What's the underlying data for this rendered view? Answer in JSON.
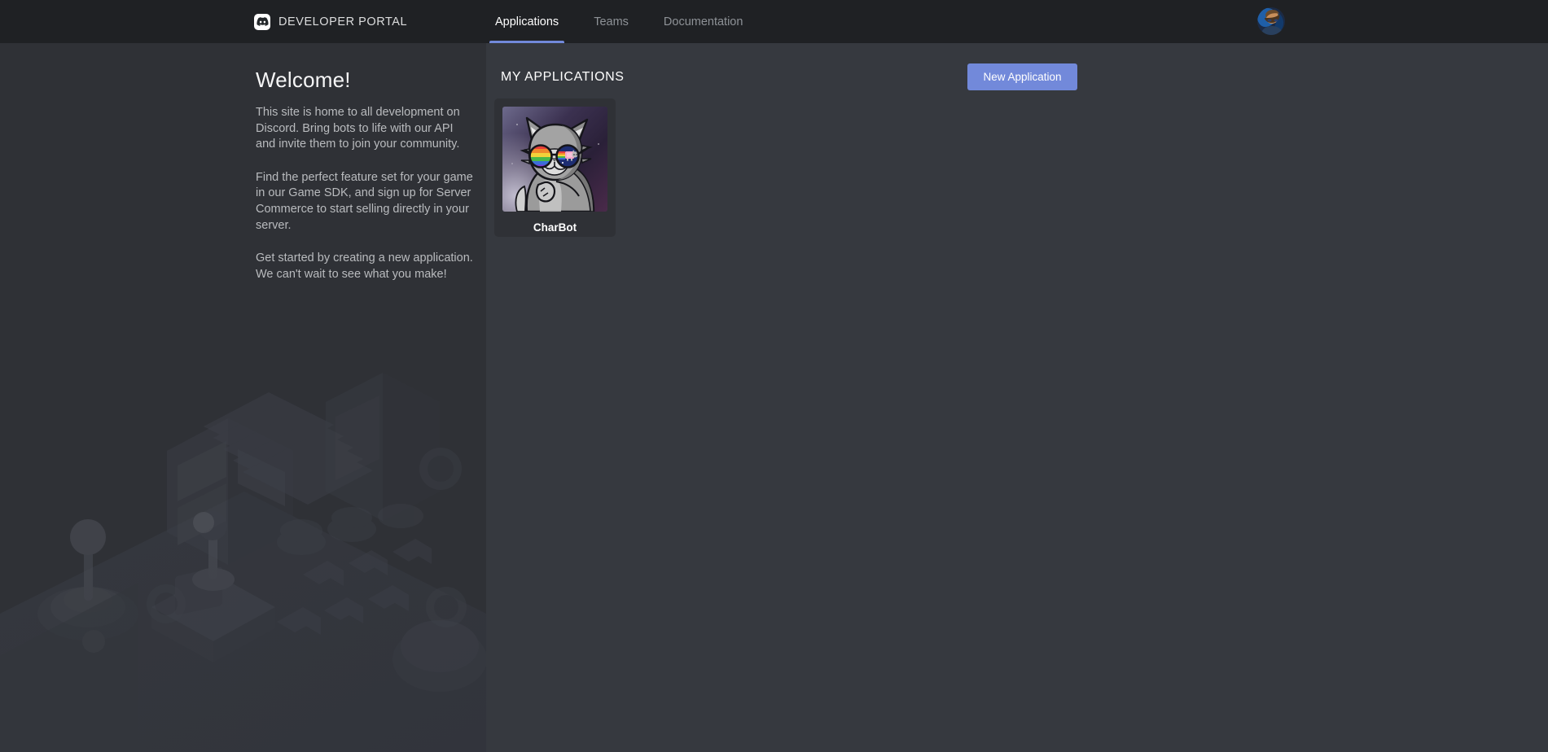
{
  "header": {
    "brand_title": "DEVELOPER PORTAL",
    "logo_icon": "discord-clyde-icon",
    "tabs": [
      {
        "label": "Applications",
        "active": true
      },
      {
        "label": "Teams",
        "active": false
      },
      {
        "label": "Documentation",
        "active": false
      }
    ],
    "avatar_icon": "user-avatar-icon",
    "background_color": "#1f2124",
    "active_tab_color": "#7289da"
  },
  "sidebar": {
    "title": "Welcome!",
    "paragraphs": [
      "This site is home to all development on Discord. Bring bots to life with our API and invite them to join your community.",
      "Find the perfect feature set for your game in our Game SDK, and sign up for Server Commerce to start selling directly in your server.",
      "Get started by creating a new application. We can't wait to see what you make!"
    ],
    "illustration_icon": "isometric-arcade-illustration",
    "background_color": "#2f3136"
  },
  "main": {
    "section_title": "MY APPLICATIONS",
    "new_application_label": "New Application",
    "background_color": "#36393f",
    "applications": [
      {
        "name": "CharBot",
        "icon": "charbot-cat-avatar-icon"
      }
    ]
  }
}
